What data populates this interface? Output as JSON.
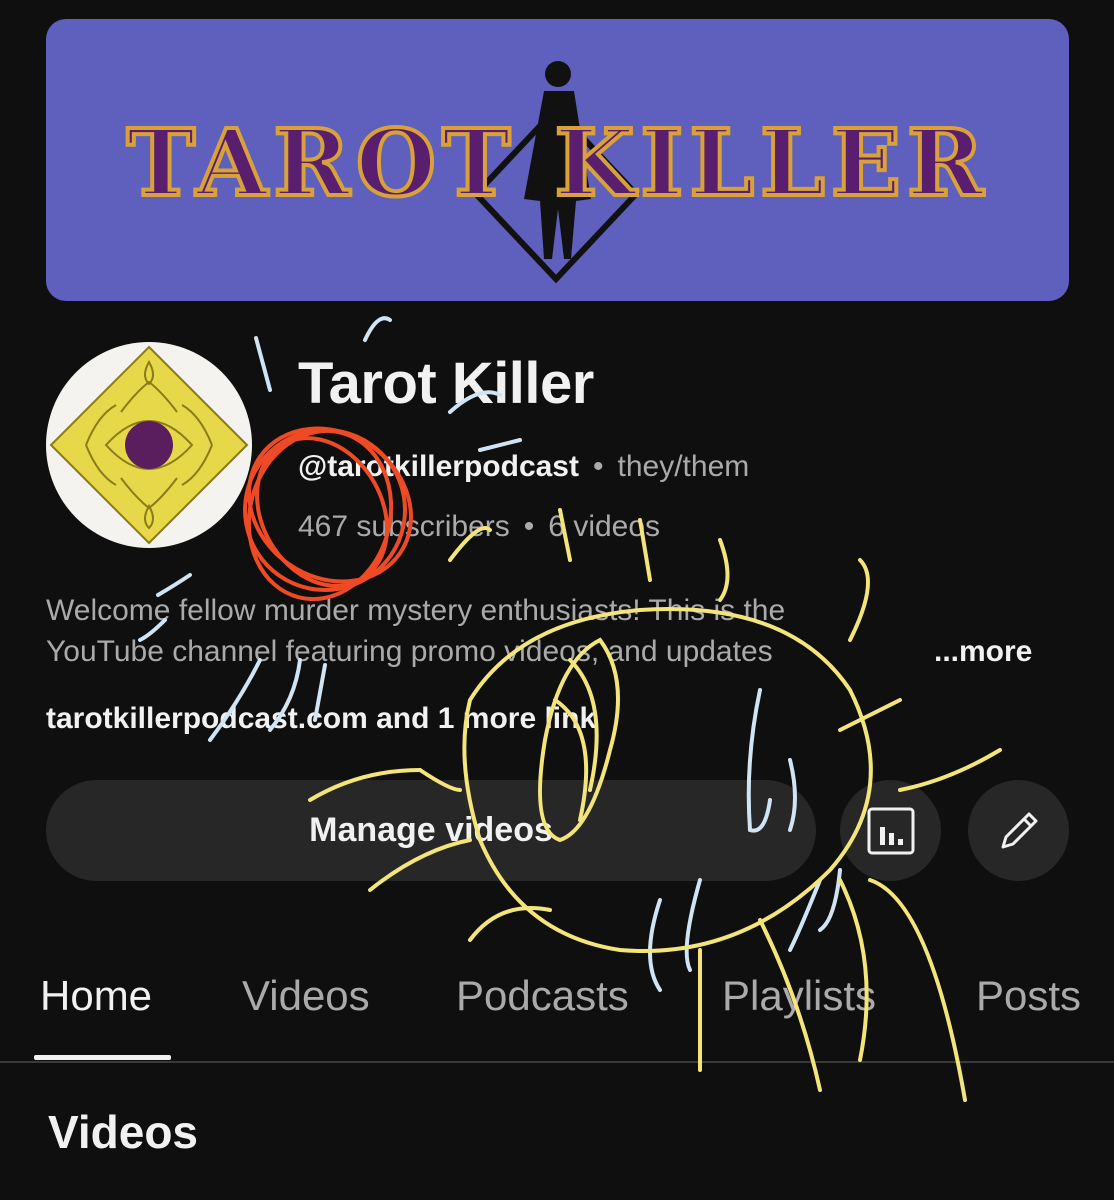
{
  "banner": {
    "logo_text": "TAROT KILLER",
    "background_color": "#5f5fbd",
    "logo_color": "#5a1e6e",
    "logo_outline_color": "#d8a13a"
  },
  "channel": {
    "name": "Tarot Killer",
    "handle": "@tarotkillerpodcast",
    "pronouns": "they/them",
    "subscribers": "467 subscribers",
    "videos_count": "6 videos",
    "separator": "•"
  },
  "description": {
    "line1": "Welcome fellow murder mystery enthusiasts! This is the",
    "line2": "YouTube channel featuring promo videos, and updates",
    "more_label": "...more"
  },
  "links": {
    "text": "tarotkillerpodcast.com and 1 more link"
  },
  "actions": {
    "manage_label": "Manage videos",
    "analytics_icon": "analytics-icon",
    "edit_icon": "pencil-icon"
  },
  "tabs": [
    {
      "label": "Home",
      "active": true
    },
    {
      "label": "Videos",
      "active": false
    },
    {
      "label": "Podcasts",
      "active": false
    },
    {
      "label": "Playlists",
      "active": false
    },
    {
      "label": "Posts",
      "active": false
    }
  ],
  "section": {
    "title": "Videos"
  },
  "colors": {
    "background": "#0f0f0f",
    "button_bg": "#272727",
    "primary_text": "#f1f1f1",
    "secondary_text": "#aaaaaa",
    "scribble_red": "#ee4a25",
    "scribble_yellow": "#f3e57a",
    "scribble_blue": "#cfe4f4"
  }
}
